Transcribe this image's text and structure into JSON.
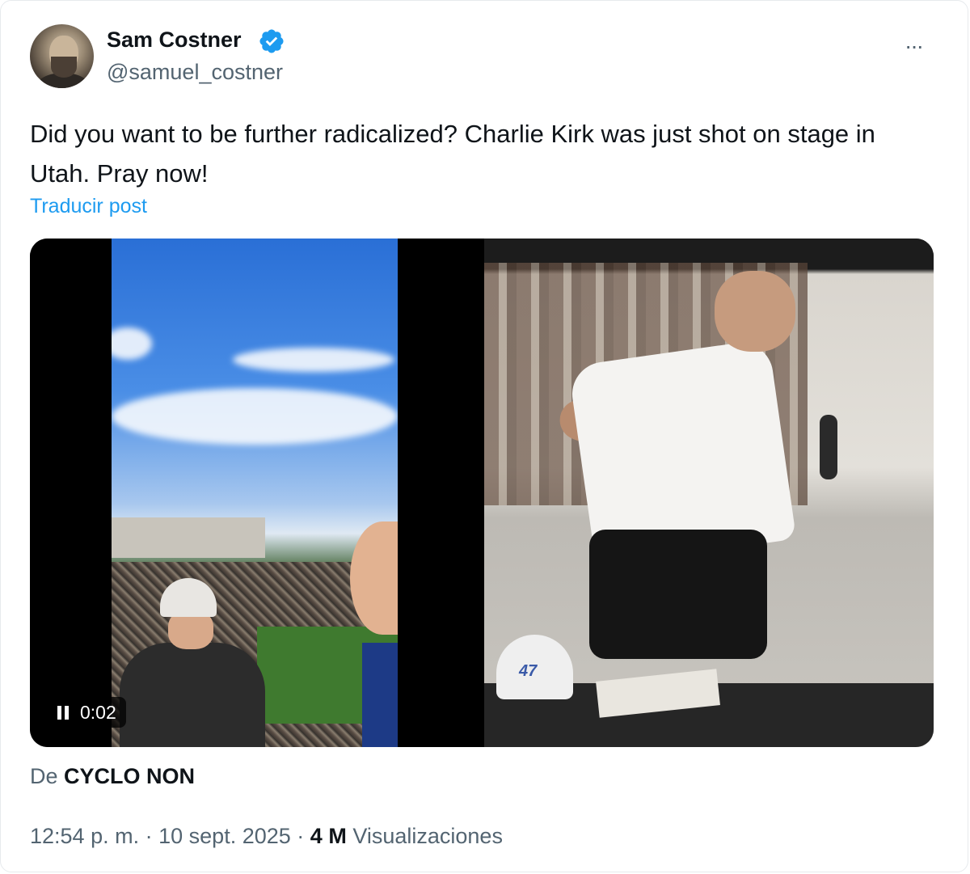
{
  "author": {
    "name": "Sam Costner",
    "handle": "@samuel_costner",
    "verified": true,
    "verified_color": "#1d9bf0"
  },
  "more_icon_label": "···",
  "post": {
    "text": "Did you want to be further radicalized? Charlie Kirk was just shot on stage in Utah. Pray now!",
    "translate_label": "Traducir post"
  },
  "media": {
    "video": {
      "time": "0:02",
      "state_icon": "pause-icon"
    },
    "image_hat_text": "47"
  },
  "source": {
    "prefix": "De",
    "name": "CYCLO NON"
  },
  "meta": {
    "time": "12:54 p. m.",
    "separator": "·",
    "date": "10 sept. 2025",
    "views_count": "4 M",
    "views_label": "Visualizaciones"
  },
  "colors": {
    "link": "#1d9bf0",
    "secondary_text": "#536471",
    "primary_text": "#0f1419"
  }
}
